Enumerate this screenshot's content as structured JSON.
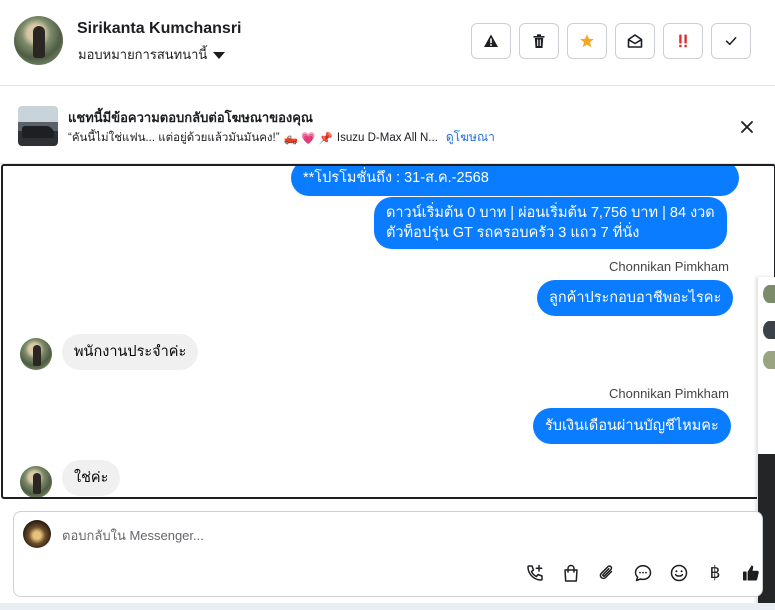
{
  "header": {
    "contact_name": "Sirikanta Kumchansri",
    "assign_label": "มอบหมายการสนทนานี้",
    "actions": [
      {
        "name": "report-spam",
        "icon": "warning-icon"
      },
      {
        "name": "delete",
        "icon": "trash-icon"
      },
      {
        "name": "star",
        "icon": "star-icon"
      },
      {
        "name": "mark-unread",
        "icon": "envelope-open-icon"
      },
      {
        "name": "follow-up",
        "icon": "double-exclamation-icon"
      },
      {
        "name": "mark-done",
        "icon": "check-icon"
      }
    ],
    "colors": {
      "star": "#f5a623",
      "follow_up": "#e02e2e"
    }
  },
  "ad_banner": {
    "title": "แชทนี้มีข้อความตอบกลับต่อโฆษณาของคุณ",
    "quote": "“คันนี้ไม่ใช่แฟน... แต่อยู่ด้วยแล้วมันมันคง!”",
    "emojis": "🛻 💗 📌",
    "ad_name": "Isuzu D-Max All N...",
    "view_ad_label": "ดูโฆษณา"
  },
  "messages": [
    {
      "dir": "out",
      "text": "**โปรโมชั่นถึง : 31-ส.ค.-2568"
    },
    {
      "dir": "out",
      "line1": "ดาวน์เริ่มต้น 0 บาท | ผ่อนเริ่มต้น 7,756 บาท | 84 งวด",
      "line2": "ตัวท็อปรุ่น GT รถครอบครัว 3 แถว 7 ที่นั่ง"
    },
    {
      "dir": "sender",
      "text": "Chonnikan Pimkham"
    },
    {
      "dir": "out",
      "text": "ลูกค้าประกอบอาชีพอะไรคะ"
    },
    {
      "dir": "in",
      "text": "พนักงานประจำค่ะ"
    },
    {
      "dir": "sender",
      "text": "Chonnikan Pimkham"
    },
    {
      "dir": "out",
      "text": "รับเงินเดือนผ่านบัญชีไหมคะ"
    },
    {
      "dir": "in",
      "text": "ใช่ค่ะ"
    }
  ],
  "composer": {
    "placeholder": "ตอบกลับใน Messenger...",
    "value": "",
    "tools": [
      "call-add-icon",
      "shopping-bag-icon",
      "paperclip-icon",
      "chat-bubble-icon",
      "smiley-icon",
      "baht-icon",
      "thumbs-up-icon"
    ],
    "baht_symbol": "฿"
  },
  "colors": {
    "outgoing_bubble": "#0a7cff",
    "incoming_bubble": "#f0f0f0",
    "link": "#216fdb"
  }
}
